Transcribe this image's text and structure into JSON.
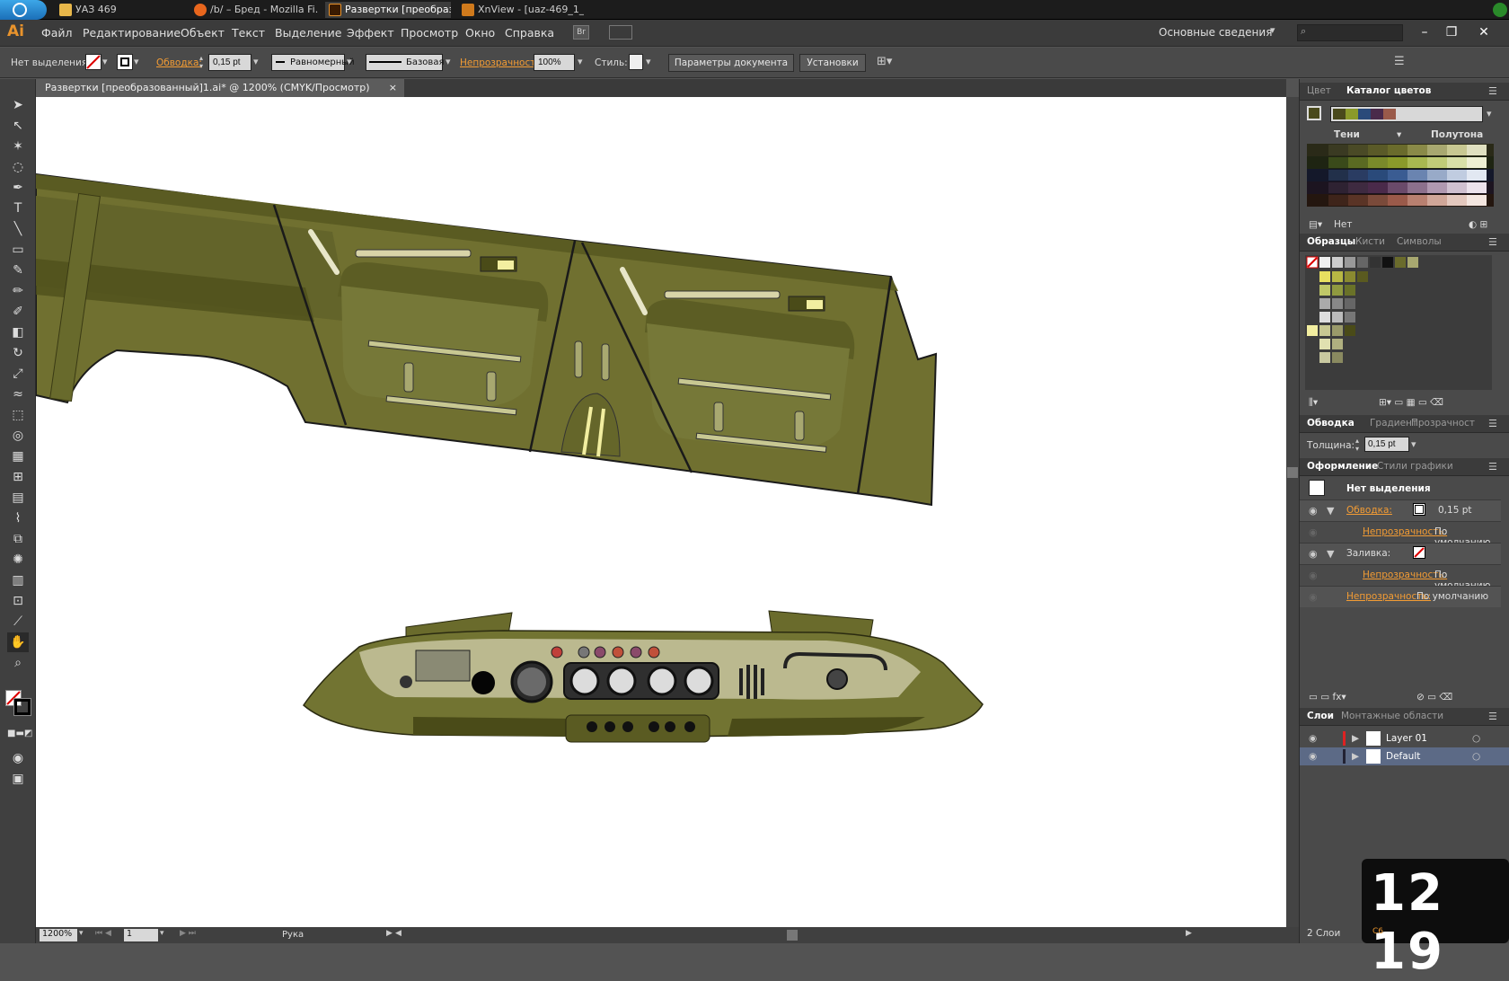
{
  "taskbar": {
    "tasks": [
      {
        "label": "УАЗ 469"
      },
      {
        "label": "/b/ – Бред - Mozilla Fi..."
      },
      {
        "label": "Развертки [преобраз..."
      },
      {
        "label": "XnView - [uaz-469_1_..."
      }
    ]
  },
  "app": {
    "logo": "Ai",
    "menu": [
      "Файл",
      "Редактирование",
      "Объект",
      "Текст",
      "Выделение",
      "Эффект",
      "Просмотр",
      "Окно",
      "Справка"
    ],
    "bridge_badge": "Br",
    "workspace": "Основные сведения",
    "search_placeholder": ""
  },
  "control": {
    "selection": "Нет выделения",
    "stroke_label": "Обводка:",
    "stroke_value": "0,15 pt",
    "profile": "Равномерный",
    "brush": "Базовая",
    "opacity_label": "Непрозрачность:",
    "opacity_value": "100%",
    "style_label": "Стиль:",
    "doc_setup": "Параметры документа",
    "prefs": "Установки"
  },
  "document": {
    "tab_title": "Развертки [преобразованный]1.ai* @ 1200% (CMYK/Просмотр)",
    "close": "×"
  },
  "status": {
    "zoom": "1200%",
    "artboard": "1",
    "tool": "Рука"
  },
  "panels": {
    "color": {
      "tabs": [
        "Цвет",
        "Каталог цветов"
      ],
      "shades": "Тени",
      "halftones": "Полутона",
      "none": "Нет"
    },
    "swatches": {
      "tabs": [
        "Образцы",
        "Кисти",
        "Символы"
      ]
    },
    "stroke": {
      "tabs": [
        "Обводка",
        "Градиент",
        "Прозрачност"
      ],
      "weight_label": "Толщина:",
      "weight_value": "0,15 pt"
    },
    "appearance": {
      "tabs": [
        "Оформление",
        "Стили графики"
      ],
      "title": "Нет выделения",
      "stroke": "Обводка:",
      "stroke_value": "0,15 pt",
      "opacity": "Непрозрачность:",
      "default": "По умолчанию",
      "fill": "Заливка:"
    },
    "layers": {
      "tabs": [
        "Слои",
        "Монтажные области"
      ],
      "items": [
        {
          "name": "Layer 01"
        },
        {
          "name": "Default"
        }
      ],
      "count": "2 Слои"
    }
  },
  "clock": {
    "time": "12 19",
    "sub": "C6"
  },
  "colors": {
    "olive": "#6b6b2a",
    "olive_dark": "#4f501c",
    "cream": "#f2eea0",
    "accent": "#f39c34"
  }
}
